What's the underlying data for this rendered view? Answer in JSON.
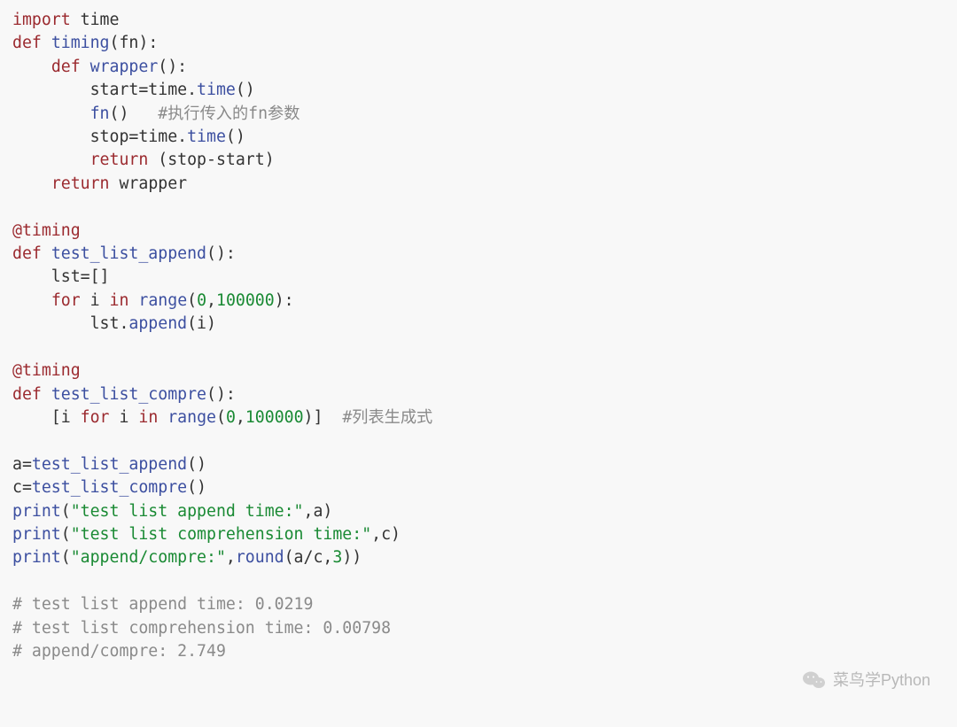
{
  "colors": {
    "bg": "#f8f8f8",
    "keyword": "#9b2a2f",
    "function": "#3c4fa0",
    "comment": "#8a8a8a",
    "number_string": "#1a8a34",
    "text": "#333333"
  },
  "code": {
    "lines": [
      [
        {
          "t": "import",
          "c": "kw"
        },
        {
          "t": " time",
          "c": "plain"
        }
      ],
      [
        {
          "t": "def",
          "c": "kw"
        },
        {
          "t": " ",
          "c": "plain"
        },
        {
          "t": "timing",
          "c": "fn"
        },
        {
          "t": "(fn):",
          "c": "plain"
        }
      ],
      [
        {
          "t": "    ",
          "c": "plain"
        },
        {
          "t": "def",
          "c": "kw"
        },
        {
          "t": " ",
          "c": "plain"
        },
        {
          "t": "wrapper",
          "c": "fn"
        },
        {
          "t": "():",
          "c": "plain"
        }
      ],
      [
        {
          "t": "        start=time.",
          "c": "plain"
        },
        {
          "t": "time",
          "c": "attr"
        },
        {
          "t": "()",
          "c": "plain"
        }
      ],
      [
        {
          "t": "        ",
          "c": "plain"
        },
        {
          "t": "fn",
          "c": "fn"
        },
        {
          "t": "()   ",
          "c": "plain"
        },
        {
          "t": "#执行传入的fn参数",
          "c": "cmt"
        }
      ],
      [
        {
          "t": "        stop=time.",
          "c": "plain"
        },
        {
          "t": "time",
          "c": "attr"
        },
        {
          "t": "()",
          "c": "plain"
        }
      ],
      [
        {
          "t": "        ",
          "c": "plain"
        },
        {
          "t": "return",
          "c": "kw"
        },
        {
          "t": " (stop-start)",
          "c": "plain"
        }
      ],
      [
        {
          "t": "    ",
          "c": "plain"
        },
        {
          "t": "return",
          "c": "kw"
        },
        {
          "t": " wrapper",
          "c": "plain"
        }
      ],
      [],
      [
        {
          "t": "@timing",
          "c": "dec"
        }
      ],
      [
        {
          "t": "def",
          "c": "kw"
        },
        {
          "t": " ",
          "c": "plain"
        },
        {
          "t": "test_list_append",
          "c": "fn"
        },
        {
          "t": "():",
          "c": "plain"
        }
      ],
      [
        {
          "t": "    lst=[]",
          "c": "plain"
        }
      ],
      [
        {
          "t": "    ",
          "c": "plain"
        },
        {
          "t": "for",
          "c": "kw"
        },
        {
          "t": " i ",
          "c": "plain"
        },
        {
          "t": "in",
          "c": "kw"
        },
        {
          "t": " ",
          "c": "plain"
        },
        {
          "t": "range",
          "c": "fn"
        },
        {
          "t": "(",
          "c": "plain"
        },
        {
          "t": "0",
          "c": "num"
        },
        {
          "t": ",",
          "c": "plain"
        },
        {
          "t": "100000",
          "c": "num"
        },
        {
          "t": "):",
          "c": "plain"
        }
      ],
      [
        {
          "t": "        lst.",
          "c": "plain"
        },
        {
          "t": "append",
          "c": "attr"
        },
        {
          "t": "(i)",
          "c": "plain"
        }
      ],
      [],
      [
        {
          "t": "@timing",
          "c": "dec"
        }
      ],
      [
        {
          "t": "def",
          "c": "kw"
        },
        {
          "t": " ",
          "c": "plain"
        },
        {
          "t": "test_list_compre",
          "c": "fn"
        },
        {
          "t": "():",
          "c": "plain"
        }
      ],
      [
        {
          "t": "    [i ",
          "c": "plain"
        },
        {
          "t": "for",
          "c": "kw"
        },
        {
          "t": " i ",
          "c": "plain"
        },
        {
          "t": "in",
          "c": "kw"
        },
        {
          "t": " ",
          "c": "plain"
        },
        {
          "t": "range",
          "c": "fn"
        },
        {
          "t": "(",
          "c": "plain"
        },
        {
          "t": "0",
          "c": "num"
        },
        {
          "t": ",",
          "c": "plain"
        },
        {
          "t": "100000",
          "c": "num"
        },
        {
          "t": ")]  ",
          "c": "plain"
        },
        {
          "t": "#列表生成式",
          "c": "cmt"
        }
      ],
      [],
      [
        {
          "t": "a=",
          "c": "plain"
        },
        {
          "t": "test_list_append",
          "c": "fn"
        },
        {
          "t": "()",
          "c": "plain"
        }
      ],
      [
        {
          "t": "c=",
          "c": "plain"
        },
        {
          "t": "test_list_compre",
          "c": "fn"
        },
        {
          "t": "()",
          "c": "plain"
        }
      ],
      [
        {
          "t": "print",
          "c": "fn"
        },
        {
          "t": "(",
          "c": "plain"
        },
        {
          "t": "\"test list append time:\"",
          "c": "str"
        },
        {
          "t": ",a)",
          "c": "plain"
        }
      ],
      [
        {
          "t": "print",
          "c": "fn"
        },
        {
          "t": "(",
          "c": "plain"
        },
        {
          "t": "\"test list comprehension time:\"",
          "c": "str"
        },
        {
          "t": ",c)",
          "c": "plain"
        }
      ],
      [
        {
          "t": "print",
          "c": "fn"
        },
        {
          "t": "(",
          "c": "plain"
        },
        {
          "t": "\"append/compre:\"",
          "c": "str"
        },
        {
          "t": ",",
          "c": "plain"
        },
        {
          "t": "round",
          "c": "fn"
        },
        {
          "t": "(a/c,",
          "c": "plain"
        },
        {
          "t": "3",
          "c": "num"
        },
        {
          "t": "))",
          "c": "plain"
        }
      ],
      [],
      [
        {
          "t": "# test list append time: 0.0219",
          "c": "cmt"
        }
      ],
      [
        {
          "t": "# test list comprehension time: 0.00798",
          "c": "cmt"
        }
      ],
      [
        {
          "t": "# append/compre: 2.749",
          "c": "cmt"
        }
      ]
    ]
  },
  "watermark": {
    "icon": "wechat-icon",
    "text": "菜鸟学Python"
  }
}
